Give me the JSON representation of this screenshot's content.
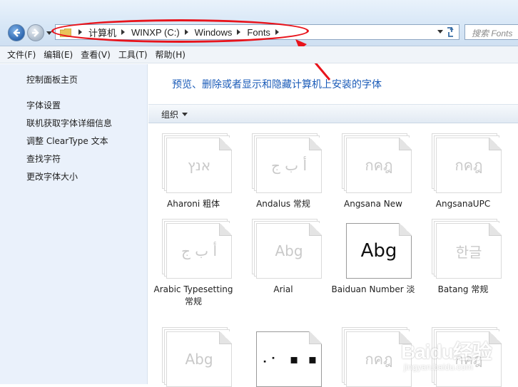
{
  "address": {
    "crumbs": [
      "计算机",
      "WINXP (C:)",
      "Windows",
      "Fonts"
    ],
    "search_placeholder": "搜索 Fonts"
  },
  "menu": [
    "文件(F)",
    "编辑(E)",
    "查看(V)",
    "工具(T)",
    "帮助(H)"
  ],
  "sidebar": {
    "links": [
      "控制面板主页",
      "字体设置",
      "联机获取字体详细信息",
      "调整 ClearType 文本",
      "查找字符",
      "更改字体大小"
    ]
  },
  "main": {
    "heading": "预览、删除或者显示和隐藏计算机上安装的字体",
    "organize_label": "组织"
  },
  "fonts": [
    {
      "name": "Aharoni 粗体",
      "sample": "אנץ",
      "highlight": false
    },
    {
      "name": "Andalus 常规",
      "sample": "أ ب ج",
      "highlight": false
    },
    {
      "name": "Angsana New",
      "sample": "กคฎ",
      "highlight": false
    },
    {
      "name": "AngsanaUPC",
      "sample": "กคฎ",
      "highlight": false
    },
    {
      "name": "Arabic Typesetting 常规",
      "sample": "أ ب ج",
      "highlight": false
    },
    {
      "name": "Arial",
      "sample": "Abg",
      "highlight": false
    },
    {
      "name": "Baiduan Number 淡",
      "sample": "Abg",
      "highlight": true
    },
    {
      "name": "Batang 常规",
      "sample": "한글",
      "highlight": false
    },
    {
      "name": "",
      "sample": "Abg",
      "highlight": false
    },
    {
      "name": "",
      "sample": "⠠⠂ ▪ ▪",
      "highlight": true
    },
    {
      "name": "",
      "sample": "กคฎ",
      "highlight": false
    },
    {
      "name": "",
      "sample": "กคฎ",
      "highlight": false
    }
  ],
  "watermark": {
    "brand": "Baidu经验",
    "url": "jingyan.baidu.com"
  },
  "colors": {
    "heading": "#1a5bb8",
    "annotation": "#e8141c",
    "sidebar_bg": "#eaf1fb"
  }
}
